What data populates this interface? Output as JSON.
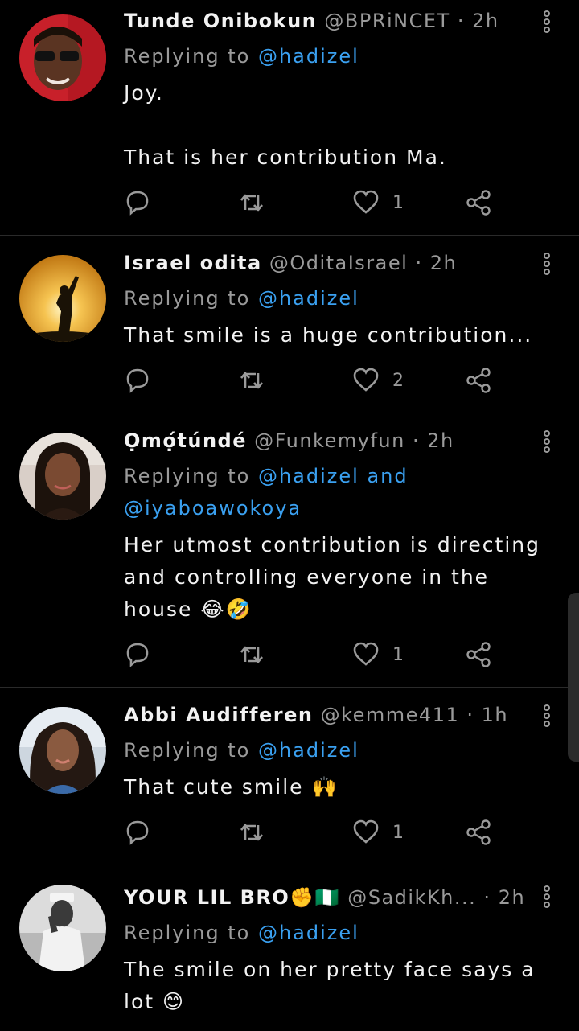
{
  "colors": {
    "background": "#000000",
    "accent": "#3aa0f0",
    "muted": "#9a9a9a",
    "text": "#f2f2f2"
  },
  "tweets": [
    {
      "name": "Tunde Onibokun",
      "handle": "@BPRiNCET",
      "sep": "·",
      "time": "2h",
      "replying_prefix": "Replying to ",
      "replying_to": "@hadizel",
      "replying_more": "",
      "body": "Joy.\n\nThat is her contribution Ma.",
      "likes": "1",
      "icons": [
        "reply-icon",
        "retweet-icon",
        "like-icon",
        "share-icon",
        "more-icon"
      ]
    },
    {
      "name": "Israel odita",
      "handle": "@OditaIsrael",
      "sep": "·",
      "time": "2h",
      "replying_prefix": "Replying to ",
      "replying_to": "@hadizel",
      "replying_more": "",
      "body": "That smile is a huge contribution...",
      "likes": "2"
    },
    {
      "name": "Ọmọ́túndé",
      "handle": "@Funkemyfun",
      "sep": "·",
      "time": "2h",
      "replying_prefix": "Replying to ",
      "replying_to": "@hadizel",
      "replying_more": "and",
      "replying_to_2": "@iyaboawokoya",
      "body": "Her utmost contribution is directing and controlling everyone in the house 😂🤣",
      "likes": "1"
    },
    {
      "name": "Abbi Audifferen",
      "handle": "@kemme411",
      "sep": "·",
      "time": "1h",
      "replying_prefix": "Replying to ",
      "replying_to": "@hadizel",
      "replying_more": "",
      "body": "That cute smile 🙌",
      "likes": "1"
    },
    {
      "name": "YOUR LIL BRO✊🇳🇬",
      "handle": "@SadikKh...",
      "sep": "·",
      "time": "2h",
      "replying_prefix": "Replying to ",
      "replying_to": "@hadizel",
      "replying_more": "",
      "body": "The smile on her pretty face says a lot 😊",
      "likes": ""
    }
  ]
}
